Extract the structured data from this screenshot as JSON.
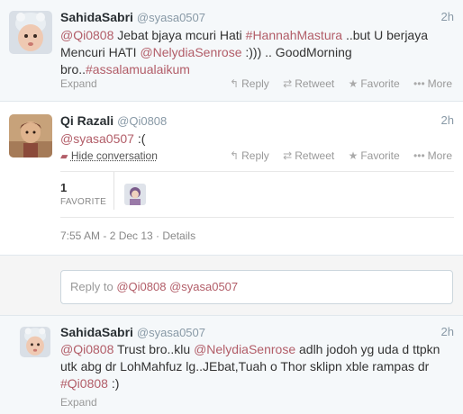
{
  "tweets": [
    {
      "fullname": "SahidaSabri",
      "handle": "@syasa0507",
      "time": "2h",
      "text": {
        "m1": "@Qi0808",
        "t1": " Jebat bjaya mcuri Hati ",
        "h1": "#HannahMastura",
        "t2": " ..but U berjaya Mencuri HATI ",
        "m2": "@NelydiaSenrose",
        "t3": " :))) .. GoodMorning bro..",
        "h2": "#assalamualaikum"
      },
      "expand": "Expand"
    },
    {
      "fullname": "Qi Razali",
      "handle": "@Qi0808",
      "time": "2h",
      "text": {
        "m1": "@syasa0507",
        "t1": " :("
      },
      "hide": "Hide conversation",
      "favorite_count": "1",
      "favorite_label": "FAVORITE",
      "meta": "7:55 AM - 2 Dec 13 · Details"
    },
    {
      "fullname": "SahidaSabri",
      "handle": "@syasa0507",
      "time": "2h",
      "text": {
        "m1": "@Qi0808",
        "t1": " Trust bro..klu ",
        "m2": "@NelydiaSenrose",
        "t2": " adlh jodoh yg uda d ttpkn utk abg dr LohMahfuz lg..JEbat,Tuah o Thor sklipn xble rampas dr ",
        "h1": "#Qi0808",
        "t3": " :)"
      },
      "expand": "Expand"
    }
  ],
  "actions": {
    "reply": "Reply",
    "retweet": "Retweet",
    "favorite": "Favorite",
    "more": "More"
  },
  "reply_box": {
    "prefix": "Reply to ",
    "m1": "@Qi0808",
    "m2": "@syasa0507"
  },
  "icons": {
    "reply": "reply-arrow",
    "retweet": "retweet-arrows",
    "favorite": "star",
    "more": "dots",
    "hide": "speech-bubble"
  },
  "colors": {
    "mention": "#b25d68",
    "muted": "#999999",
    "name": "#292f33",
    "bg_alt": "#f5f8fa"
  }
}
